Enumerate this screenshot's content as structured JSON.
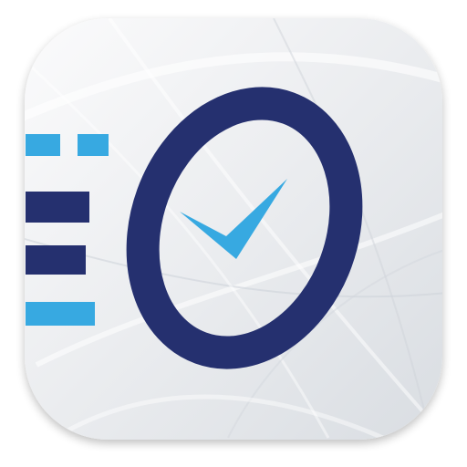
{
  "app_icon": {
    "icon": "checklist-o-checkmark-icon",
    "colors": {
      "tile_light": "#fbfbfc",
      "tile_mid": "#e9ebee",
      "tile_dark": "#d9dde2",
      "o_ring": "#25306f",
      "checkmark": "#37a9e1",
      "bar_cyan": "#37a9e1",
      "bar_navy": "#25306f"
    }
  }
}
